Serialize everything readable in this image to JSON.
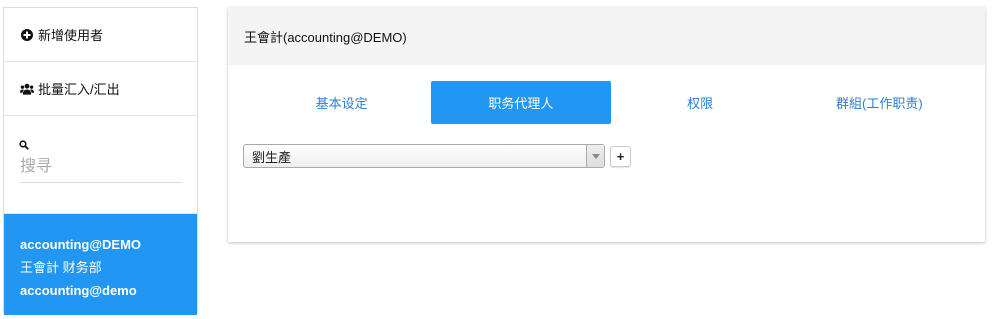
{
  "sidebar": {
    "add_user_label": "新增使用者",
    "batch_label": "批量汇入/汇出",
    "search_placeholder": "搜寻",
    "selected_user": {
      "account": "accounting@DEMO",
      "name_dept": "王會計 财务部",
      "email": "accounting@demo"
    }
  },
  "panel": {
    "title": "王會計(accounting@DEMO)",
    "tabs": [
      "基本设定",
      "职务代理人",
      "权限",
      "群組(工作职责)"
    ],
    "active_tab": "职务代理人",
    "delegate_value": "劉生產",
    "add_label": "+"
  },
  "colors": {
    "accent": "#2196f3",
    "link": "#2a7fd4"
  },
  "icons": {
    "add_user": "plus-circle-icon",
    "batch": "users-icon",
    "search": "search-icon",
    "dropdown": "caret-down-icon"
  }
}
